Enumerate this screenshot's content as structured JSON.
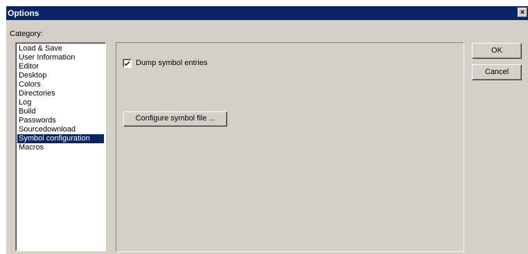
{
  "window": {
    "title": "Options",
    "close_glyph": "×"
  },
  "category": {
    "label": "Category:",
    "items": [
      "Load & Save",
      "User Information",
      "Editor",
      "Desktop",
      "Colors",
      "Directories",
      "Log",
      "Build",
      "Passwords",
      "Sourcedownload",
      "Symbol configuration",
      "Macros"
    ],
    "selected": "Symbol configuration"
  },
  "panel": {
    "dump_symbol_entries": {
      "label": "Dump symbol entries",
      "checked": true
    },
    "configure_button_label": "Configure symbol file ..."
  },
  "buttons": {
    "ok": "OK",
    "cancel": "Cancel"
  },
  "colors": {
    "title_bar": "#0a246a",
    "face": "#d4d0c8",
    "selection": "#0a246a"
  }
}
